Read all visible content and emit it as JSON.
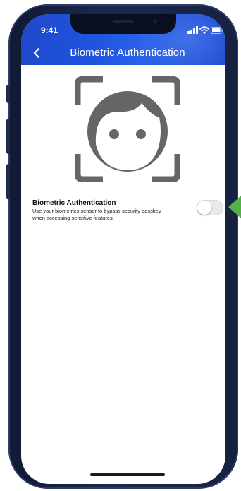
{
  "status_bar": {
    "time": "9:41",
    "icons": [
      "signal-icon",
      "wifi-icon",
      "battery-icon"
    ]
  },
  "header": {
    "back_icon": "chevron-left-icon",
    "title": "Biometric Authentication",
    "colors": {
      "start": "#1f48c9",
      "end": "#2a62e8"
    }
  },
  "illustration": {
    "icon": "face-scan-icon",
    "color": "#666666"
  },
  "setting": {
    "title": "Biometric Authentication",
    "description": "Use your biometrics sensor to bypass security passkey when accessing sensitive features.",
    "toggle_enabled": false
  },
  "callout": {
    "icon": "arrow-left-icon",
    "color": "#55b04a"
  },
  "colors": {
    "frame": "#15223f",
    "toggle_off": "#e9e9ea"
  }
}
